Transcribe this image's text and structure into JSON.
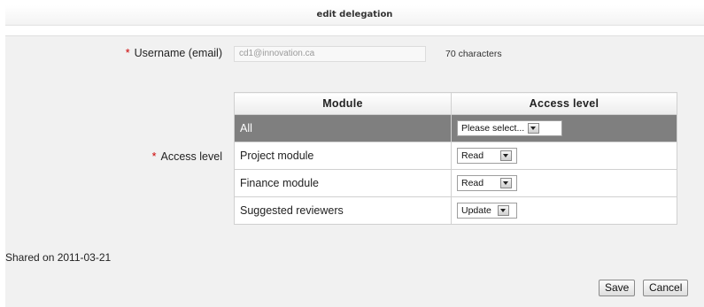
{
  "window": {
    "title": "edit delegation"
  },
  "form": {
    "username": {
      "required_mark": "*",
      "label": "Username (email)",
      "value": "cd1@innovation.ca",
      "char_count": "70  characters"
    },
    "access_level": {
      "required_mark": "*",
      "label": "Access level",
      "columns": [
        "Module",
        "Access level"
      ],
      "rows": [
        {
          "module": "All",
          "selected": "Please select..."
        },
        {
          "module": "Project module",
          "selected": "Read"
        },
        {
          "module": "Finance module",
          "selected": "Read"
        },
        {
          "module": "Suggested reviewers",
          "selected": "Update"
        }
      ]
    },
    "shared_on": "Shared on 2011-03-21"
  },
  "actions": {
    "save_label": "Save",
    "cancel_label": "Cancel"
  },
  "colors": {
    "panel_bg": "#f1f1f1",
    "highlight_row": "#7f7f7f",
    "required": "#cc0000"
  }
}
